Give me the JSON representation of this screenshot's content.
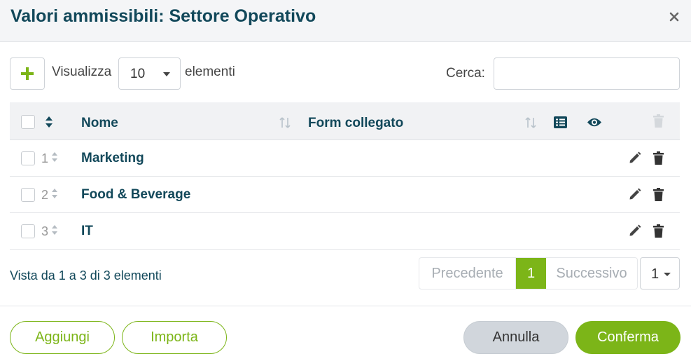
{
  "dialog": {
    "title": "Valori ammissibili: Settore Operativo"
  },
  "toolbar": {
    "show_label": "Visualizza",
    "page_length": "10",
    "elements_label": "elementi",
    "search_label": "Cerca:",
    "search_value": "",
    "search_placeholder": ""
  },
  "table": {
    "columns": {
      "name": "Nome",
      "linked_form": "Form collegato"
    },
    "rows": [
      {
        "num": "1",
        "name": "Marketing",
        "linked_form": ""
      },
      {
        "num": "2",
        "name": "Food & Beverage",
        "linked_form": ""
      },
      {
        "num": "3",
        "name": "IT",
        "linked_form": ""
      }
    ]
  },
  "pagination": {
    "info": "Vista da 1 a 3 di 3 elementi",
    "previous": "Precedente",
    "current": "1",
    "next": "Successivo",
    "page_select": "1"
  },
  "footer": {
    "add": "Aggiungi",
    "import": "Importa",
    "cancel": "Annulla",
    "confirm": "Conferma"
  },
  "colors": {
    "accent": "#7cb518",
    "title": "#12485a",
    "header_bg": "#f4f5f7"
  },
  "icons": {
    "close": "close-icon",
    "add": "plus-icon",
    "sort": "sort-icon",
    "list": "list-icon",
    "visibility": "eye-icon",
    "edit": "pencil-icon",
    "delete": "trash-icon"
  }
}
